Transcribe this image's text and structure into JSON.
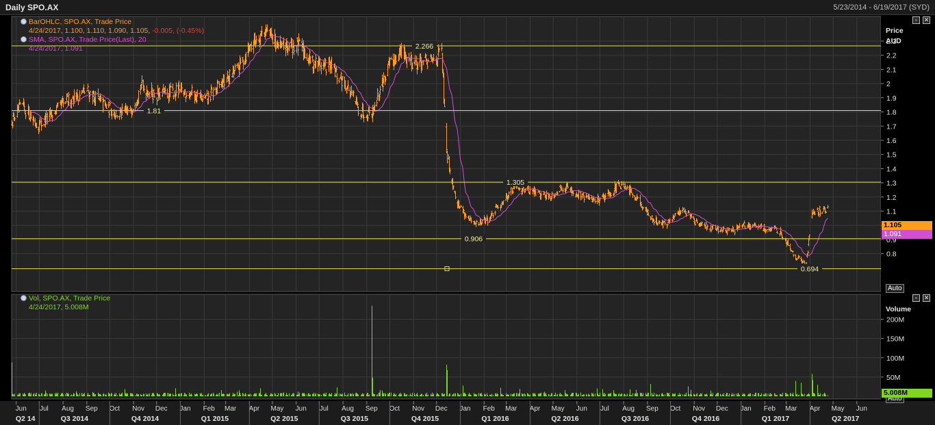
{
  "window": {
    "title": "Daily SPO.AX",
    "date_range": "5/23/2014 - 6/19/2017 (SYD)"
  },
  "price_panel": {
    "legend": {
      "bar_series": "BarOHLC, SPO.AX, Trade Price",
      "bar_values": "4/24/2017, 1.100, 1.110, 1.090, 1.105,",
      "bar_change": "-0.005, (-0.45%)",
      "sma_series": "SMA, SPO.AX, Trade Price(Last),  20",
      "sma_values": "4/24/2017, 1.091"
    },
    "axis_title": "Price",
    "axis_unit": "AUD",
    "auto_label": "Auto",
    "last_price_label": "1.105",
    "sma_price_label": "1.091"
  },
  "volume_panel": {
    "legend": {
      "series": "Vol, SPO.AX, Trade Price",
      "values": "4/24/2017, 5.008M"
    },
    "axis_title": "Volume",
    "auto_label": "Auto",
    "last_volume_label": "5.008M"
  },
  "colors": {
    "bars": "#ff9c1a",
    "sma": "#d050d0",
    "volume": "#7fd620",
    "hlines": "#e8e040",
    "change_negative": "#ff3030",
    "grid": "#3a3a3a"
  },
  "icons": {
    "restore": "restore-icon",
    "close": "close-icon",
    "legend_dot": "legend-dot-icon"
  },
  "chart_data": [
    {
      "type": "ohlc_bar",
      "title": "Daily SPO.AX",
      "ylabel": "Price AUD",
      "ylim": [
        0.7,
        2.45
      ],
      "y_ticks": [
        0.8,
        0.9,
        1,
        1.1,
        1.2,
        1.3,
        1.4,
        1.5,
        1.6,
        1.7,
        1.8,
        1.9,
        2,
        2.1,
        2.2,
        2.3
      ],
      "x_month_labels": [
        "Jun",
        "Jul",
        "Aug",
        "Sep",
        "Oct",
        "Nov",
        "Dec",
        "Jan",
        "Feb",
        "Mar",
        "Apr",
        "May",
        "Jun",
        "Jul",
        "Aug",
        "Sep",
        "Oct",
        "Nov",
        "Dec",
        "Jan",
        "Feb",
        "Mar",
        "Apr",
        "May",
        "Jun",
        "Jul",
        "Aug",
        "Sep",
        "Oct",
        "Nov",
        "Dec",
        "Jan",
        "Feb",
        "Mar",
        "Apr",
        "May",
        "Jun"
      ],
      "x_quarter_labels": [
        "Q2 14",
        "Q3 2014",
        "Q4 2014",
        "Q1 2015",
        "Q2 2015",
        "Q3 2015",
        "Q4 2015",
        "Q1 2016",
        "Q2 2016",
        "Q3 2016",
        "Q4 2016",
        "Q1 2017",
        "Q2 2017"
      ],
      "horizontal_lines": [
        {
          "value": 2.266,
          "label": "2.266"
        },
        {
          "value": 1.81,
          "label": "1.81"
        },
        {
          "value": 1.305,
          "label": "1.305"
        },
        {
          "value": 0.906,
          "label": "0.906"
        },
        {
          "value": 0.694,
          "label": "0.694"
        }
      ],
      "approx_close_path": [
        [
          "2014-05-26",
          1.74
        ],
        [
          "2014-06-09",
          1.84
        ],
        [
          "2014-06-30",
          1.7
        ],
        [
          "2014-07-21",
          1.8
        ],
        [
          "2014-08-11",
          1.9
        ],
        [
          "2014-09-01",
          1.95
        ],
        [
          "2014-09-22",
          1.85
        ],
        [
          "2014-10-13",
          1.78
        ],
        [
          "2014-10-27",
          1.8
        ],
        [
          "2014-11-10",
          1.98
        ],
        [
          "2014-12-01",
          1.92
        ],
        [
          "2014-12-22",
          1.94
        ],
        [
          "2015-01-12",
          1.94
        ],
        [
          "2015-02-02",
          1.88
        ],
        [
          "2015-02-23",
          2.0
        ],
        [
          "2015-03-16",
          2.1
        ],
        [
          "2015-04-06",
          2.3
        ],
        [
          "2015-04-20",
          2.38
        ],
        [
          "2015-05-11",
          2.25
        ],
        [
          "2015-06-01",
          2.28
        ],
        [
          "2015-06-22",
          2.15
        ],
        [
          "2015-07-13",
          2.12
        ],
        [
          "2015-08-03",
          2.0
        ],
        [
          "2015-08-24",
          1.8
        ],
        [
          "2015-09-07",
          1.8
        ],
        [
          "2015-09-28",
          2.1
        ],
        [
          "2015-10-12",
          2.22
        ],
        [
          "2015-11-02",
          2.15
        ],
        [
          "2015-11-23",
          2.15
        ],
        [
          "2015-12-07",
          2.22
        ],
        [
          "2015-12-14",
          1.5
        ],
        [
          "2015-12-28",
          1.15
        ],
        [
          "2016-01-18",
          1.0
        ],
        [
          "2016-02-08",
          1.05
        ],
        [
          "2016-02-29",
          1.2
        ],
        [
          "2016-03-14",
          1.28
        ],
        [
          "2016-04-04",
          1.24
        ],
        [
          "2016-04-25",
          1.2
        ],
        [
          "2016-05-16",
          1.28
        ],
        [
          "2016-06-06",
          1.2
        ],
        [
          "2016-06-27",
          1.18
        ],
        [
          "2016-07-11",
          1.22
        ],
        [
          "2016-07-25",
          1.28
        ],
        [
          "2016-08-15",
          1.22
        ],
        [
          "2016-09-05",
          1.05
        ],
        [
          "2016-09-26",
          1.0
        ],
        [
          "2016-10-17",
          1.12
        ],
        [
          "2016-11-07",
          1.0
        ],
        [
          "2016-11-28",
          0.98
        ],
        [
          "2016-12-19",
          0.96
        ],
        [
          "2017-01-09",
          1.0
        ],
        [
          "2017-01-30",
          0.98
        ],
        [
          "2017-02-20",
          0.96
        ],
        [
          "2017-03-13",
          0.78
        ],
        [
          "2017-03-27",
          0.72
        ],
        [
          "2017-04-03",
          1.1
        ],
        [
          "2017-04-24",
          1.105
        ]
      ],
      "series": [
        {
          "name": "BarOHLC, SPO.AX, Trade Price",
          "last": {
            "date": "4/24/2017",
            "open": 1.1,
            "high": 1.11,
            "low": 1.09,
            "close": 1.105,
            "change": -0.005,
            "change_pct": -0.45
          }
        },
        {
          "name": "SMA, SPO.AX, Trade Price(Last),  20",
          "last": {
            "date": "4/24/2017",
            "value": 1.091
          }
        }
      ]
    },
    {
      "type": "bar",
      "title": "",
      "ylabel": "Volume",
      "ylim": [
        0,
        250
      ],
      "y_ticks_labels": [
        "50M",
        "100M",
        "150M",
        "200M"
      ],
      "y_ticks_values": [
        50,
        100,
        150,
        200
      ],
      "unit": "M",
      "approx_baseline": 5,
      "spikes": [
        [
          "2014-05-26",
          88
        ],
        [
          "2014-08-18",
          13
        ],
        [
          "2015-09-07",
          235
        ],
        [
          "2015-09-08",
          48
        ],
        [
          "2015-12-14",
          82
        ],
        [
          "2015-12-15",
          68
        ],
        [
          "2016-01-04",
          28
        ],
        [
          "2016-02-22",
          22
        ],
        [
          "2016-05-16",
          16
        ],
        [
          "2016-06-27",
          20
        ],
        [
          "2016-09-05",
          32
        ],
        [
          "2016-10-24",
          26
        ],
        [
          "2017-03-13",
          40
        ],
        [
          "2017-03-20",
          35
        ],
        [
          "2017-04-03",
          58
        ],
        [
          "2017-04-04",
          42
        ],
        [
          "2017-04-10",
          30
        ]
      ],
      "series": [
        {
          "name": "Vol, SPO.AX, Trade Price",
          "last": {
            "date": "4/24/2017",
            "value": 5.008
          }
        }
      ]
    }
  ]
}
